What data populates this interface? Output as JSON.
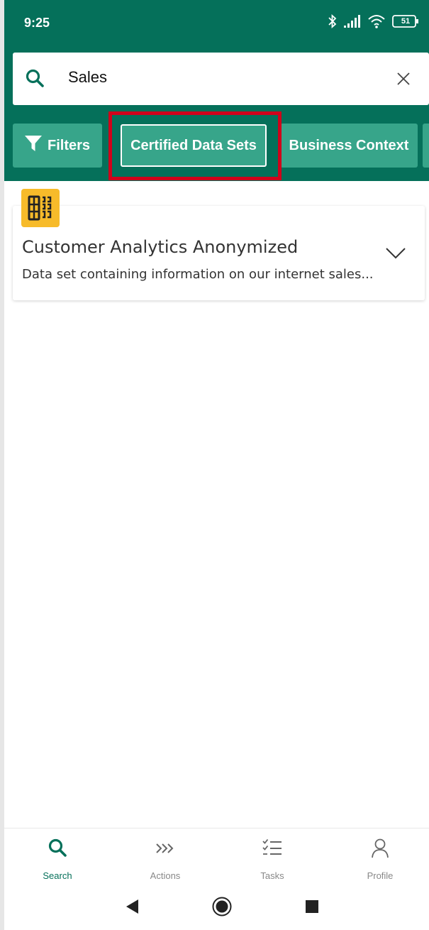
{
  "status_bar": {
    "time": "9:25",
    "battery_level": "51"
  },
  "search": {
    "query": "Sales"
  },
  "chips": {
    "filters_label": "Filters",
    "certified_label": "Certified Data Sets",
    "business_label": "Business Context"
  },
  "results": [
    {
      "title": "Customer Analytics Anonymized",
      "description": "Data set containing information on our internet sales..."
    }
  ],
  "bottom_nav": {
    "search": "Search",
    "actions": "Actions",
    "tasks": "Tasks",
    "profile": "Profile"
  },
  "colors": {
    "header_green": "#05705a",
    "chip_green": "#37a58a",
    "highlight_red": "#d0021b",
    "dataset_icon_yellow": "#f7bb2a"
  }
}
